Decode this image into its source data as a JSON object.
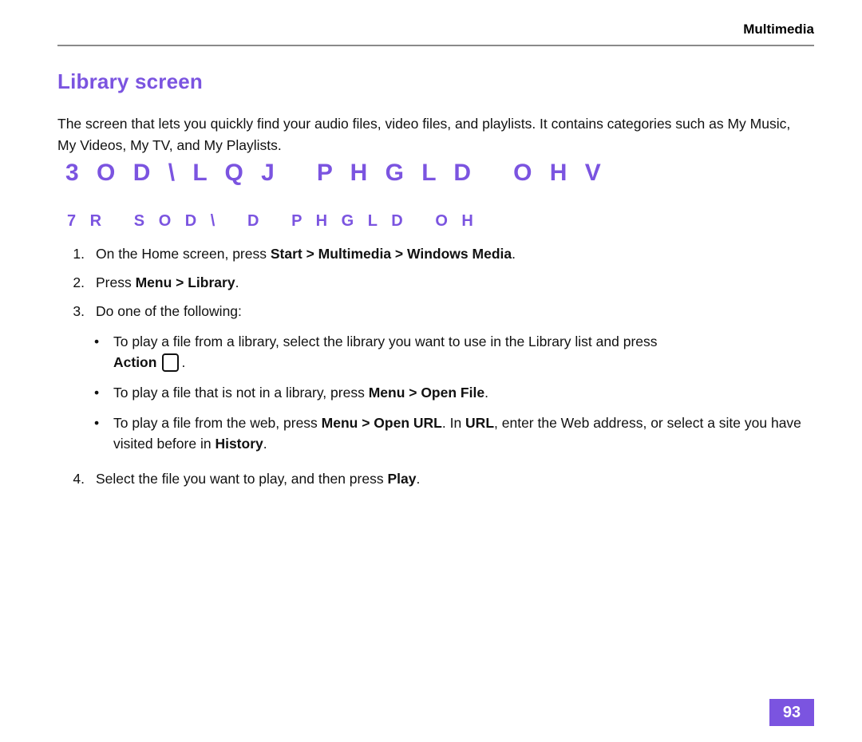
{
  "header": {
    "section_label": "Multimedia"
  },
  "title": "Library screen",
  "intro": "The screen that lets you quickly find your audio files, video files, and playlists. It contains categories such as My Music, My Videos, My TV, and My Playlists.",
  "headings": {
    "main": "3 O D \\ L Q J   P H G L D   O H V",
    "sub": "7 R   S O D \\   D   P H G L D   O H"
  },
  "steps": [
    {
      "number": "1.",
      "parts": [
        {
          "text": "On the Home screen, press ",
          "bold": false
        },
        {
          "text": "Start > Multimedia > Windows Media",
          "bold": true
        },
        {
          "text": ".",
          "bold": false
        }
      ]
    },
    {
      "number": "2.",
      "parts": [
        {
          "text": "Press ",
          "bold": false
        },
        {
          "text": "Menu > Library",
          "bold": true
        },
        {
          "text": ".",
          "bold": false
        }
      ]
    },
    {
      "number": "3.",
      "parts": [
        {
          "text": "Do one of the following:",
          "bold": false
        }
      ]
    }
  ],
  "bullets": [
    {
      "marker": "•",
      "parts": [
        {
          "text": "To play a file from a library, select the library you want to use in the Library list and press ",
          "bold": false
        }
      ],
      "has_action_key": true,
      "action_label": "Action",
      "action_suffix": "."
    },
    {
      "marker": "•",
      "parts": [
        {
          "text": "To play a file that is not in a library, press ",
          "bold": false
        },
        {
          "text": "Menu > Open File",
          "bold": true
        },
        {
          "text": ".",
          "bold": false
        }
      ],
      "has_action_key": false
    },
    {
      "marker": "•",
      "parts": [
        {
          "text": "To play a file from the web, press ",
          "bold": false
        },
        {
          "text": "Menu > Open URL",
          "bold": true
        },
        {
          "text": ". In ",
          "bold": false
        },
        {
          "text": "URL",
          "bold": true
        },
        {
          "text": ", enter the Web address, or select a site you have visited before in ",
          "bold": false
        },
        {
          "text": "History",
          "bold": true
        },
        {
          "text": ".",
          "bold": false
        }
      ],
      "has_action_key": false
    }
  ],
  "final_step": {
    "number": "4.",
    "parts": [
      {
        "text": "Select the file you want to play, and then press ",
        "bold": false
      },
      {
        "text": "Play",
        "bold": true
      },
      {
        "text": ".",
        "bold": false
      }
    ]
  },
  "page_number": "93",
  "colors": {
    "accent": "#7b54e0",
    "rule": "#8a8a8a",
    "text": "#111111"
  }
}
